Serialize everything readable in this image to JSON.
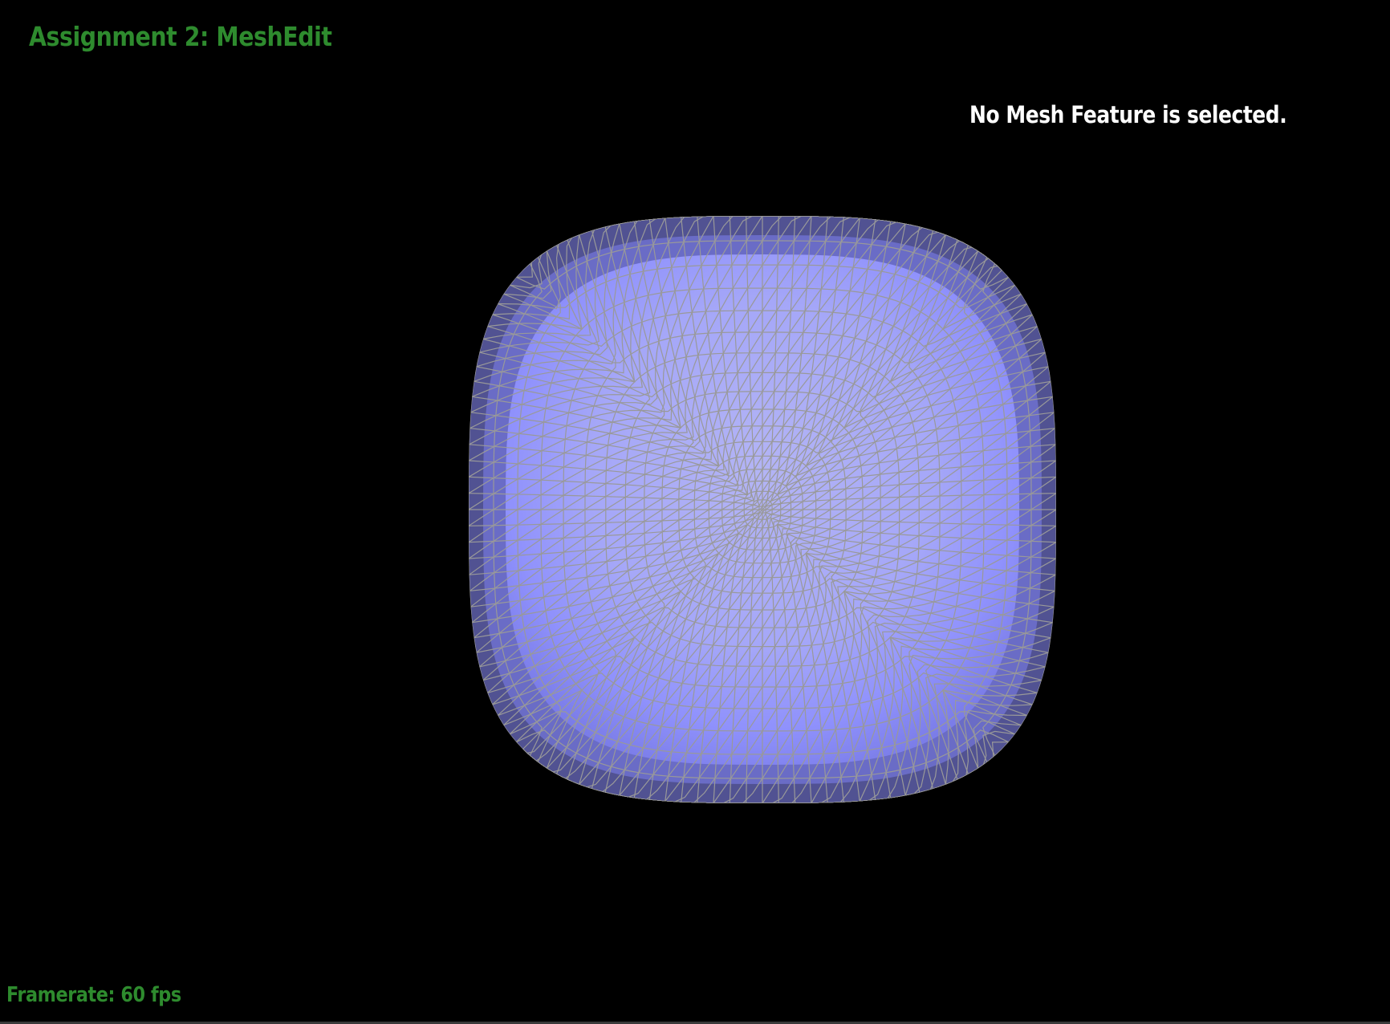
{
  "window": {
    "title": "Assignment 2: MeshEdit"
  },
  "status": {
    "selection": "No Mesh Feature is selected."
  },
  "footer": {
    "framerate": "Framerate: 60 fps"
  },
  "mesh": {
    "shape": "rounded-cube",
    "face_color": "#8a8cff",
    "highlight_color": "#b3b4ff",
    "edge_color": "#999999",
    "render_mode": "transparent-wireframe"
  },
  "colors": {
    "background": "#000000",
    "title": "#2e8b2e",
    "status_text": "#ffffff",
    "framerate": "#2e8b2e"
  }
}
